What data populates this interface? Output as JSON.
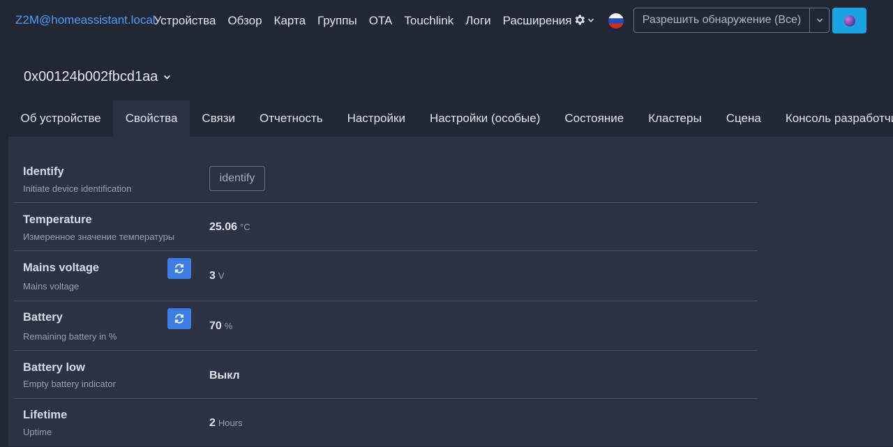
{
  "navbar": {
    "brand": "Z2M@homeassistant.local",
    "links": [
      "Устройства",
      "Обзор",
      "Карта",
      "Группы",
      "OTA",
      "Touchlink",
      "Логи",
      "Расширения"
    ],
    "permit_join_label": "Разрешить обнаружение (Все)",
    "icons": {
      "settings": "gear-icon",
      "language": "russia-flag-icon",
      "theme": "moon-icon"
    }
  },
  "device": {
    "title": "0x00124b002fbcd1aa"
  },
  "tabs": [
    "Об устройстве",
    "Свойства",
    "Связи",
    "Отчетность",
    "Настройки",
    "Настройки (особые)",
    "Состояние",
    "Кластеры",
    "Сцена",
    "Консоль разработчика"
  ],
  "active_tab": "Свойства",
  "properties": [
    {
      "title": "Identify",
      "description": "Initiate device identification",
      "button": "identify"
    },
    {
      "title": "Temperature",
      "description": "Измеренное значение температуры",
      "value": "25.06",
      "unit": "°C"
    },
    {
      "title": "Mains voltage",
      "description": "Mains voltage",
      "value": "3",
      "unit": "V"
    },
    {
      "title": "Battery",
      "description": "Remaining battery in %",
      "value": "70",
      "unit": "%"
    },
    {
      "title": "Battery low",
      "description": "Empty battery indicator",
      "value": "Выкл"
    },
    {
      "title": "Lifetime",
      "description": "Uptime",
      "value": "2",
      "unit": "Hours"
    }
  ],
  "colors": {
    "background": "#222736",
    "panel": "#2c3244",
    "accent_link": "#4d9df5",
    "refresh_button": "#3c7ee6",
    "theme_button": "#1aa3e0"
  }
}
